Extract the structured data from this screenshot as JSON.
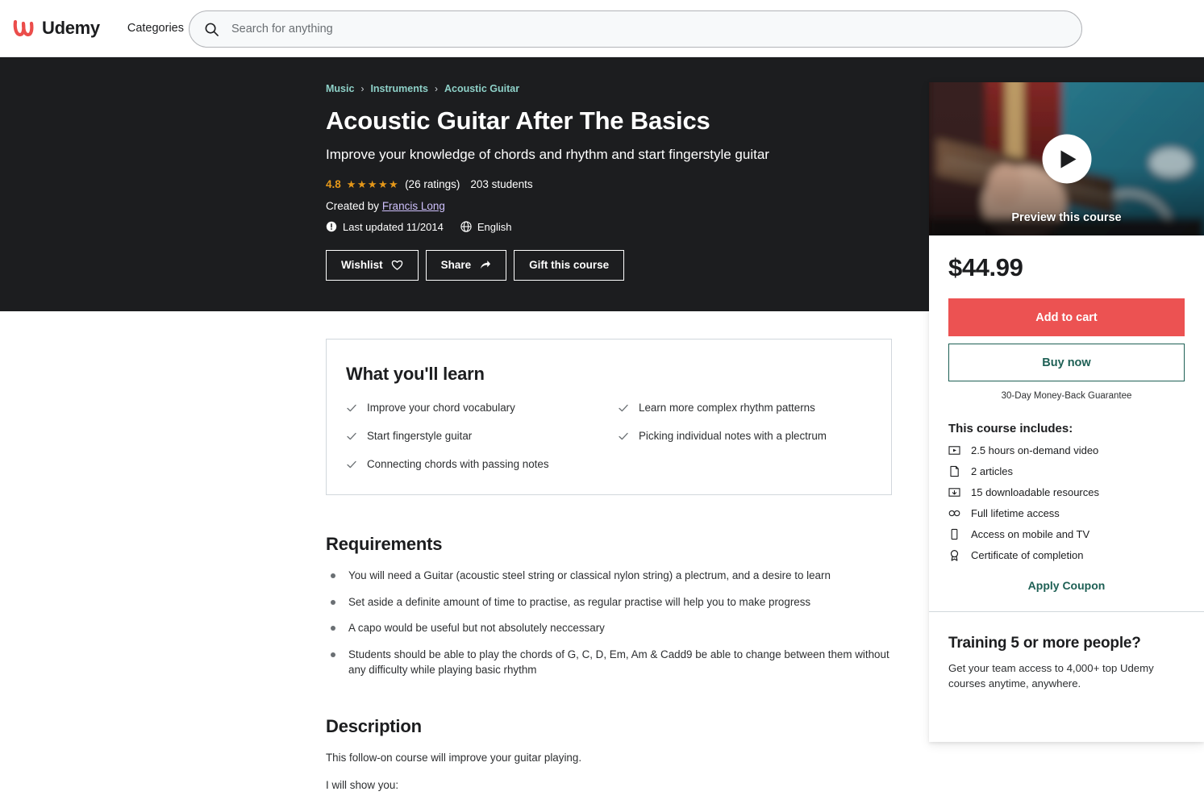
{
  "header": {
    "logo_text": "Udemy",
    "logo_icon": "udemy-u-logo-icon",
    "categories_label": "Categories",
    "search": {
      "placeholder": "Search for anything",
      "value": "",
      "icon": "search-icon"
    }
  },
  "hero": {
    "breadcrumb": [
      {
        "label": "Music"
      },
      {
        "label": "Instruments"
      },
      {
        "label": "Acoustic Guitar"
      }
    ],
    "breadcrumb_separator": "›",
    "title": "Acoustic Guitar After The Basics",
    "subtitle": "Improve your knowledge of chords and rhythm and start fingerstyle guitar",
    "rating_value": "4.8",
    "stars": "★★★★★",
    "rating_count": "(26 ratings)",
    "students": "203 students",
    "created_by_label": "Created by",
    "instructor": "Francis Long",
    "last_updated": "Last updated 11/2014",
    "last_updated_icon": "info-circle-icon",
    "language": "English",
    "language_icon": "globe-icon",
    "buttons": [
      {
        "label": "Wishlist",
        "icon": "heart-icon"
      },
      {
        "label": "Share",
        "icon": "share-arrow-icon"
      },
      {
        "label": "Gift this course",
        "icon": "none"
      }
    ]
  },
  "what_you_learn": {
    "title": "What you'll learn",
    "check_icon": "check-icon",
    "items": [
      "Improve your chord vocabulary",
      "Learn more complex rhythm patterns",
      "Start fingerstyle guitar",
      "Picking individual notes with a plectrum",
      "Connecting chords with passing notes"
    ]
  },
  "requirements": {
    "title": "Requirements",
    "items": [
      "You will need a Guitar (acoustic steel string or classical nylon string) a plectrum, and a desire to learn",
      "Set aside a definite amount of time to practise, as regular practise will help you to make progress",
      "A capo would be useful but not absolutely neccessary",
      "Students should be able to play the chords of G, C, D, Em, Am & Cadd9 be able to change between them without any difficulty while playing basic rhythm"
    ]
  },
  "description": {
    "title": "Description",
    "paragraphs": [
      "This follow-on course will improve your guitar playing.",
      "I will show you:"
    ]
  },
  "purchase_card": {
    "preview_label": "Preview this course",
    "play_icon": "play-icon",
    "price": "$44.99",
    "add_to_cart_label": "Add to cart",
    "buy_now_label": "Buy now",
    "guarantee": "30-Day Money-Back Guarantee",
    "includes_title": "This course includes:",
    "includes": [
      {
        "label": "2.5 hours on-demand video",
        "icon": "video-play-box-icon"
      },
      {
        "label": "2 articles",
        "icon": "article-page-icon"
      },
      {
        "label": "15 downloadable resources",
        "icon": "download-box-icon"
      },
      {
        "label": "Full lifetime access",
        "icon": "infinity-icon"
      },
      {
        "label": "Access on mobile and TV",
        "icon": "mobile-device-icon"
      },
      {
        "label": "Certificate of completion",
        "icon": "certificate-badge-icon"
      }
    ],
    "apply_coupon_label": "Apply Coupon",
    "training_title": "Training 5 or more people?",
    "training_text": "Get your team access to 4,000+ top Udemy courses anytime, anywhere."
  },
  "colors": {
    "hero_background": "#1c1d1f",
    "accent_red": "#ec5252",
    "accent_teal": "#1e6055",
    "breadcrumb_link": "#8ed1c8",
    "instructor_link": "#cec0fc",
    "star_amber": "#e59819"
  }
}
